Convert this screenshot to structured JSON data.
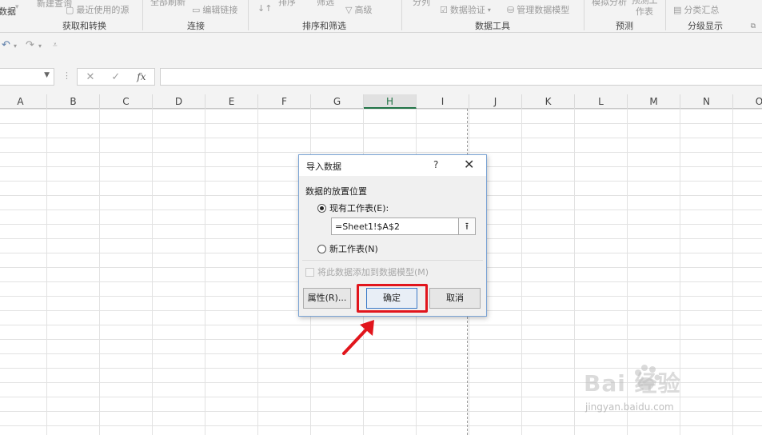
{
  "ribbon": {
    "cut_left_label": "数据",
    "items": {
      "new_query": "新建查询",
      "recent_sources": "最近使用的源",
      "refresh_all": "全部刷新",
      "edit_links": "编辑链接",
      "sort": "排序",
      "filter": "筛选",
      "advanced": "高级",
      "split": "分列",
      "data_validation": "数据验证",
      "manage_model": "管理数据模型",
      "whatif": "模拟分析",
      "forecast_sheet": "预测工作表",
      "subtotal": "分类汇总"
    },
    "groups": {
      "get_transform": "获取和转换",
      "connections": "连接",
      "sort_filter": "排序和筛选",
      "data_tools": "数据工具",
      "forecast": "预测",
      "outline": "分级显示"
    }
  },
  "formula_bar": {
    "name_box": "",
    "cancel_symbol": "✕",
    "enter_symbol": "✓",
    "fx_symbol": "fx",
    "formula": ""
  },
  "columns": [
    "A",
    "B",
    "C",
    "D",
    "E",
    "F",
    "G",
    "H",
    "I",
    "J",
    "K",
    "L",
    "M",
    "N",
    "O"
  ],
  "active_column": "H",
  "dialog": {
    "title": "导入数据",
    "help": "?",
    "close": "✕",
    "section_label": "数据的放置位置",
    "radio_existing": "现有工作表(E):",
    "radio_new": "新工作表(N)",
    "reference": "=Sheet1!$A$2",
    "checkbox_label": "将此数据添加到数据模型(M)",
    "btn_properties": "属性(R)...",
    "btn_ok": "确定",
    "btn_cancel": "取消"
  },
  "watermark": {
    "main": "Bai  经验",
    "sub": "jingyan.baidu.com"
  },
  "colors": {
    "highlight": "#e1151c",
    "accent_green": "#217346",
    "dialog_border": "#7aa3d4"
  }
}
